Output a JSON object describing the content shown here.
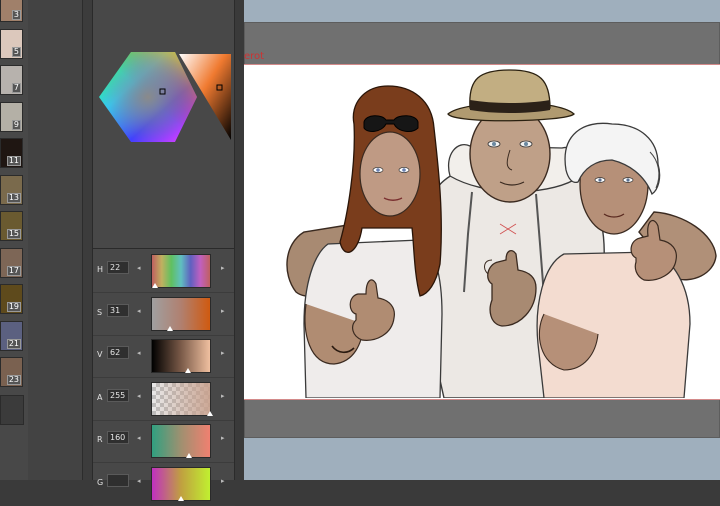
{
  "swatches": [
    {
      "number": "3",
      "color": "#a0806a"
    },
    {
      "number": "5",
      "color": "#dcc8bc"
    },
    {
      "number": "7",
      "color": "#b7b2ad"
    },
    {
      "number": "9",
      "color": "#b4b0a6"
    },
    {
      "number": "11",
      "color": "#1f1612"
    },
    {
      "number": "13",
      "color": "#7a6a4c"
    },
    {
      "number": "15",
      "color": "#6a5a30"
    },
    {
      "number": "17",
      "color": "#7d6656"
    },
    {
      "number": "19",
      "color": "#5e4a1c"
    },
    {
      "number": "21",
      "color": "#5b6080"
    },
    {
      "number": "23",
      "color": "#7a6150"
    }
  ],
  "sliders": [
    {
      "label": "H",
      "value": "22",
      "gradient": "linear-gradient(90deg,#c06060,#c0b060,#60c060,#60c0c0,#6060c0,#c060c0,#c06060)",
      "thumb": 0.06
    },
    {
      "label": "S",
      "value": "31",
      "gradient": "linear-gradient(90deg,#a0a0a0,#b08070,#d05a10)",
      "thumb": 0.31
    },
    {
      "label": "V",
      "value": "62",
      "gradient": "linear-gradient(90deg,#000000,#7a5a48,#f0c0a0)",
      "thumb": 0.62
    },
    {
      "label": "A",
      "value": "255",
      "gradient": "checker",
      "thumb": 1.0
    },
    {
      "label": "R",
      "value": "160",
      "gradient": "linear-gradient(90deg,#30a080,#a09070,#f08070)",
      "thumb": 0.63
    },
    {
      "label": "G",
      "value": "",
      "gradient": "linear-gradient(90deg,#c030c0,#c0a040,#c0f030)",
      "thumb": 0.5
    }
  ],
  "canvas": {
    "title": "erot"
  },
  "colors": {
    "canvas_bg": "#9fafbd",
    "frame": "#707070",
    "paper": "#ffffff",
    "accent_red": "#cc3333"
  }
}
